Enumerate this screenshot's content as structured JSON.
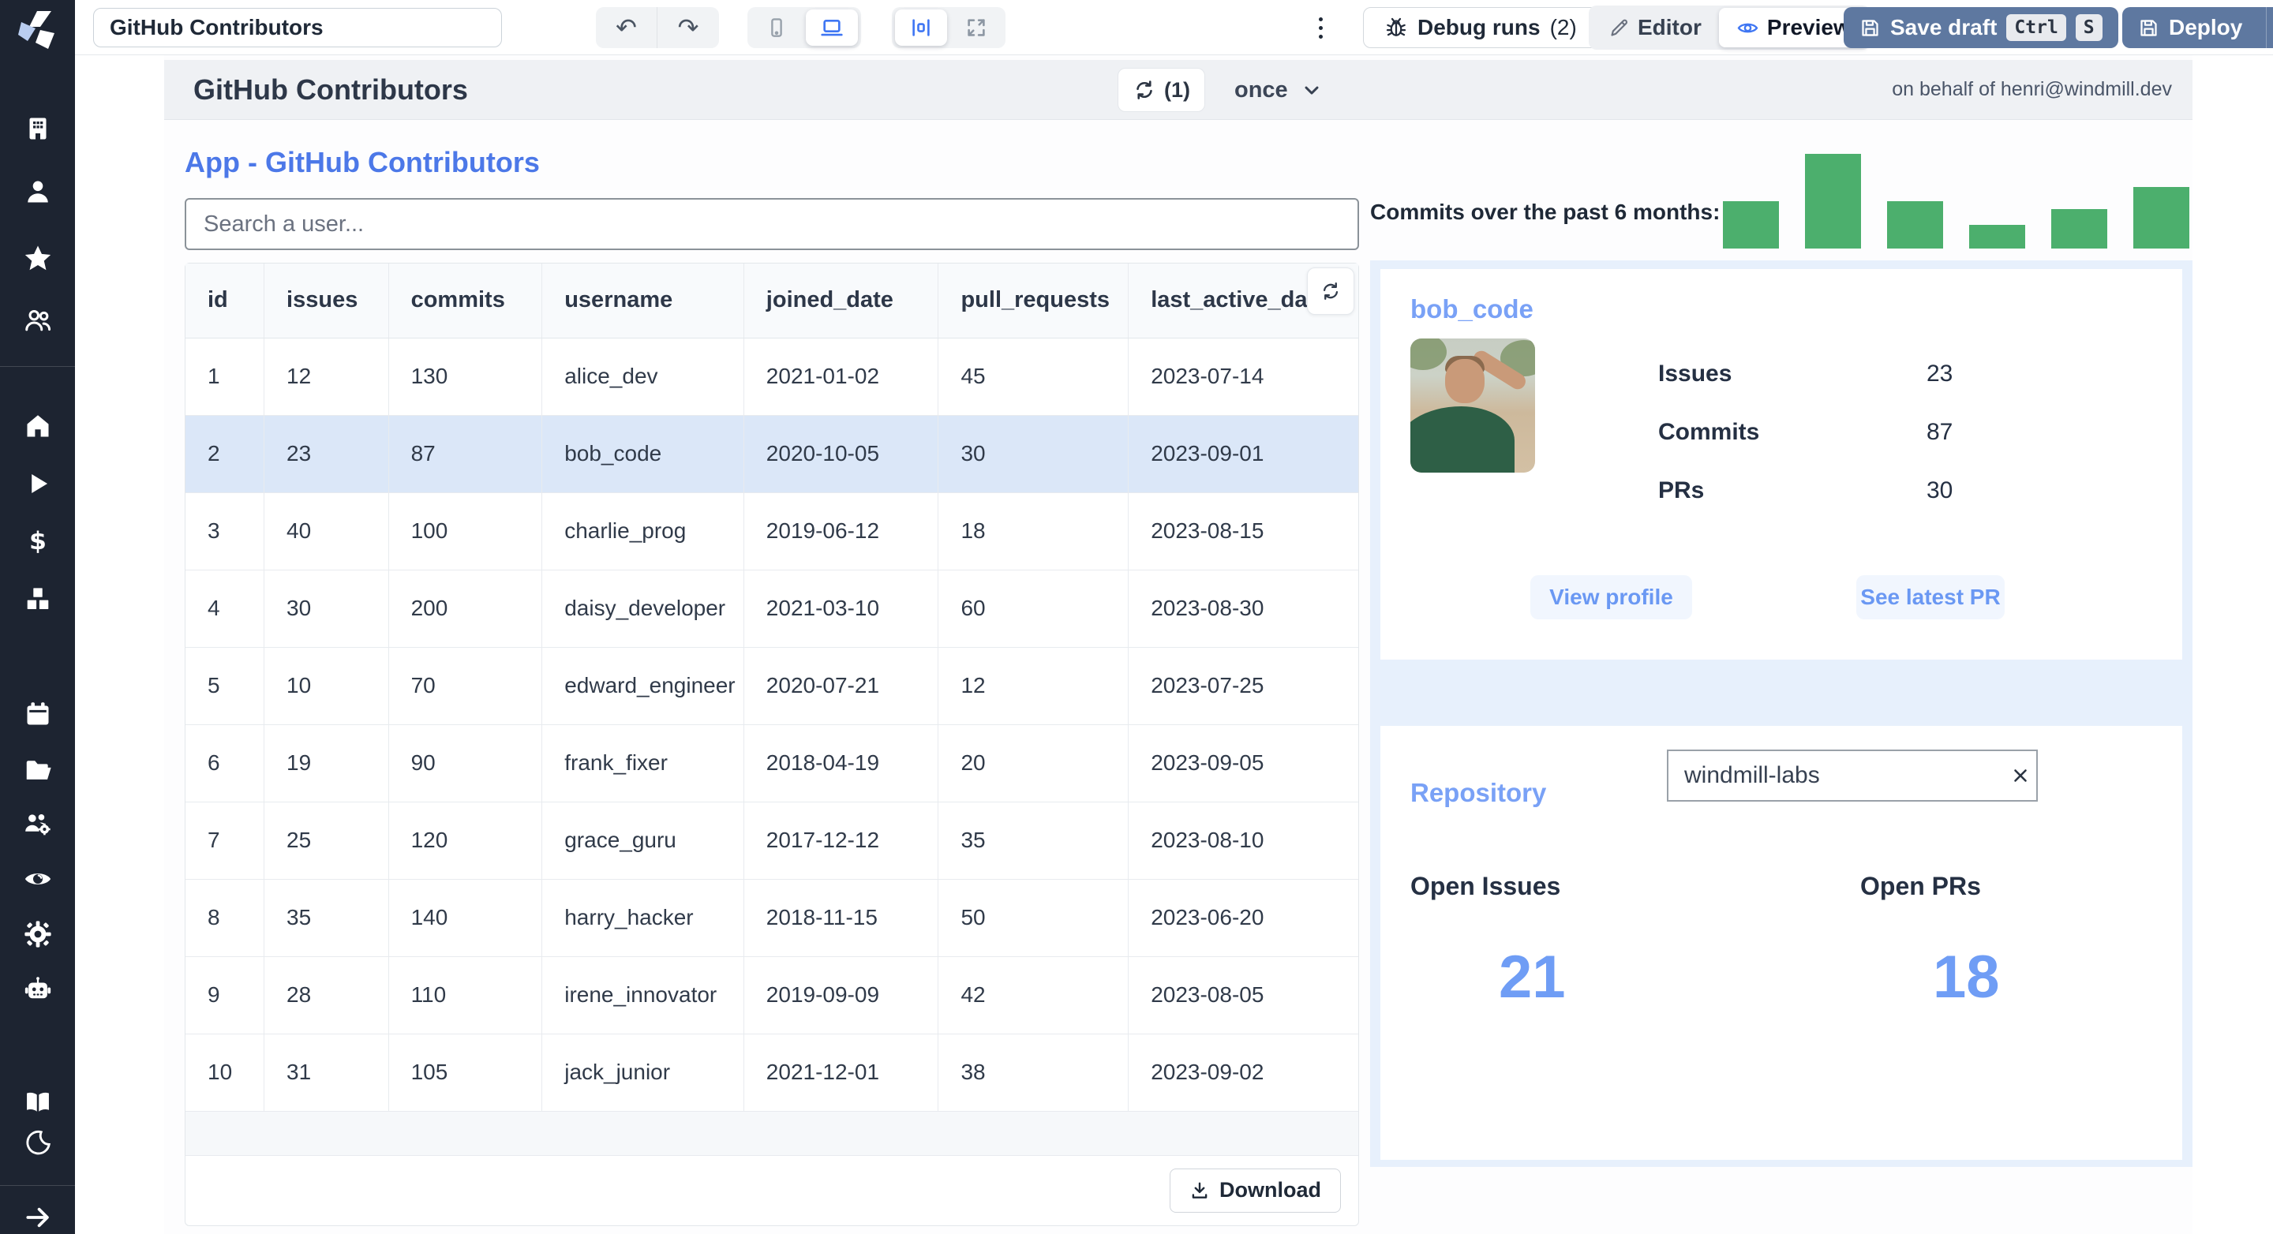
{
  "colors": {
    "sidebar_bg": "#1d2431",
    "accent_blue": "#3f76f3",
    "heading_blue": "#4c78e8",
    "card_heading_blue": "#79a1f6",
    "big_number_blue": "#6f9df5",
    "bar_green": "#4caf6d",
    "panel_blue": "#e7f0fc",
    "selected_row_blue": "#dbe7f8",
    "slate_button": "#5e78a0"
  },
  "sidebar": {
    "icons": [
      "windmill-logo",
      "building",
      "user",
      "star",
      "users",
      "home",
      "play",
      "dollar",
      "cubes",
      "calendar",
      "folder",
      "users-gear",
      "eye",
      "gear",
      "robot",
      "book",
      "moon",
      "arrow-right"
    ]
  },
  "toolbar": {
    "app_title_value": "GitHub Contributors",
    "debug_runs_label": "Debug runs",
    "debug_runs_count": "(2)",
    "editor_label": "Editor",
    "preview_label": "Preview",
    "save_draft_label": "Save draft",
    "save_kbd": [
      "Ctrl",
      "S"
    ],
    "deploy_label": "Deploy"
  },
  "app_header": {
    "title": "GitHub Contributors",
    "refresh_count": "(1)",
    "schedule_label": "once",
    "on_behalf": "on behalf of henri@windmill.dev"
  },
  "main": {
    "heading": "App - GitHub Contributors",
    "search_placeholder": "Search a user...",
    "download_label": "Download"
  },
  "table": {
    "columns": [
      "id",
      "issues",
      "commits",
      "username",
      "joined_date",
      "pull_requests",
      "last_active_date"
    ],
    "selected_row_index": 1,
    "rows": [
      [
        "1",
        "12",
        "130",
        "alice_dev",
        "2021-01-02",
        "45",
        "2023-07-14"
      ],
      [
        "2",
        "23",
        "87",
        "bob_code",
        "2020-10-05",
        "30",
        "2023-09-01"
      ],
      [
        "3",
        "40",
        "100",
        "charlie_prog",
        "2019-06-12",
        "18",
        "2023-08-15"
      ],
      [
        "4",
        "30",
        "200",
        "daisy_developer",
        "2021-03-10",
        "60",
        "2023-08-30"
      ],
      [
        "5",
        "10",
        "70",
        "edward_engineer",
        "2020-07-21",
        "12",
        "2023-07-25"
      ],
      [
        "6",
        "19",
        "90",
        "frank_fixer",
        "2018-04-19",
        "20",
        "2023-09-05"
      ],
      [
        "7",
        "25",
        "120",
        "grace_guru",
        "2017-12-12",
        "35",
        "2023-08-10"
      ],
      [
        "8",
        "35",
        "140",
        "harry_hacker",
        "2018-11-15",
        "50",
        "2023-06-20"
      ],
      [
        "9",
        "28",
        "110",
        "irene_innovator",
        "2019-09-09",
        "42",
        "2023-08-05"
      ],
      [
        "10",
        "31",
        "105",
        "jack_junior",
        "2021-12-01",
        "38",
        "2023-09-02"
      ]
    ]
  },
  "chart_data": {
    "type": "bar",
    "title": "Commits over the past 6 months:",
    "values": [
      50,
      100,
      50,
      25,
      42,
      65
    ],
    "value_units": "relative height %, no axis shown",
    "bar_color": "#4caf6d",
    "xlabel": "",
    "ylabel": "",
    "grid": false,
    "legend": false
  },
  "user_card": {
    "username": "bob_code",
    "avatar": "photo of contributor bob_code",
    "stats": [
      {
        "label": "Issues",
        "value": "23"
      },
      {
        "label": "Commits",
        "value": "87"
      },
      {
        "label": "PRs",
        "value": "30"
      }
    ],
    "view_profile_label": "View profile",
    "see_latest_pr_label": "See latest PR"
  },
  "repo_card": {
    "title": "Repository",
    "input_value": "windmill-labs",
    "open_issues_label": "Open Issues",
    "open_issues_value": "21",
    "open_prs_label": "Open PRs",
    "open_prs_value": "18"
  }
}
